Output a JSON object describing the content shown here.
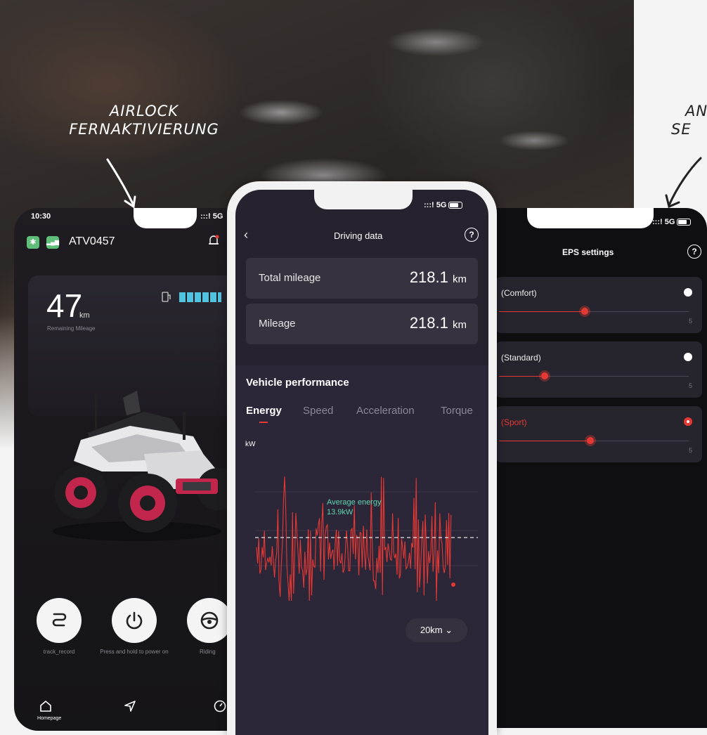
{
  "annotations": {
    "left_line1": "AIRLOCK",
    "left_line2": "FERNAKTIVIERUNG",
    "right_line1": "AN",
    "right_line2": "SE"
  },
  "left_phone": {
    "status_time": "10:30",
    "status_signal": ":::! 5G",
    "device_name": "ATV0457",
    "remaining_mileage_value": "47",
    "remaining_mileage_unit": "km",
    "remaining_mileage_label": "Remaining Mileage",
    "battery_level": 0.8,
    "actions": [
      {
        "label": "track_record",
        "icon": "track-icon"
      },
      {
        "label": "Press and hold to power on",
        "icon": "power-icon"
      },
      {
        "label": "Riding",
        "icon": "steering-wheel-icon"
      }
    ],
    "tabs": [
      {
        "label": "Homepage",
        "icon": "home-icon"
      },
      {
        "label": "",
        "icon": "navigate-icon"
      },
      {
        "label": "",
        "icon": "gauge-icon"
      }
    ]
  },
  "middle_phone": {
    "status_signal": ":::! 5G",
    "title": "Driving data",
    "cards": [
      {
        "label": "Total mileage",
        "value": "218.1",
        "unit": "km"
      },
      {
        "label": "Mileage",
        "value": "218.1",
        "unit": "km"
      }
    ],
    "perf_title": "Vehicle performance",
    "tabs": [
      "Energy",
      "Speed",
      "Acceleration",
      "Torque"
    ],
    "active_tab": 0,
    "axis_unit": "kW",
    "avg_label_line1": "Average energy",
    "avg_label_line2": "13.9kW",
    "range_label": "20km ⌄"
  },
  "right_phone": {
    "status_signal": ":::! 5G",
    "title": "EPS settings",
    "modes": [
      {
        "label": "(Comfort)",
        "selected": false,
        "level": 0.45,
        "max": "5"
      },
      {
        "label": "(Standard)",
        "selected": false,
        "level": 0.24,
        "max": "5"
      },
      {
        "label": "(Sport)",
        "selected": true,
        "level": 0.48,
        "max": "5"
      }
    ]
  },
  "colors": {
    "accent_red": "#e53935",
    "avg_green": "#5fd6b2",
    "battery_blue": "#4fc3e0",
    "status_green": "#5fbf7a"
  }
}
